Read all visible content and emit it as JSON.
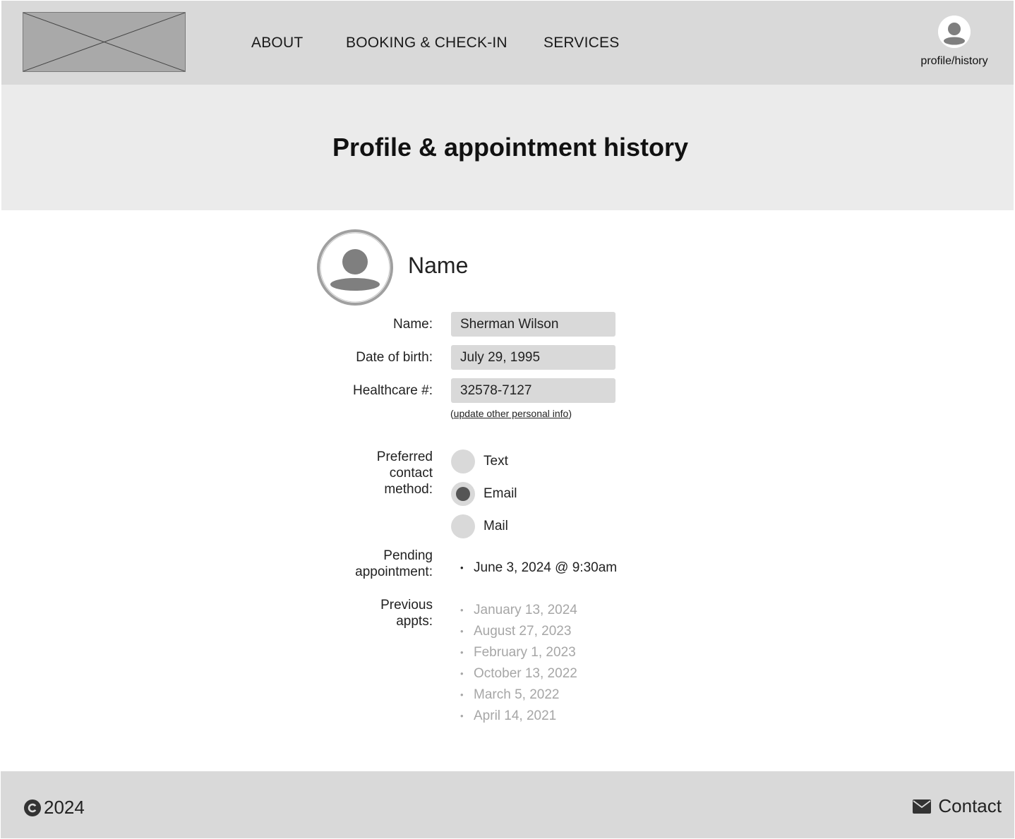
{
  "header": {
    "nav": {
      "about": "ABOUT",
      "booking": "BOOKING & CHECK-IN",
      "services": "SERVICES"
    },
    "profile_label": "profile/history"
  },
  "banner": {
    "title": "Profile & appointment history"
  },
  "profile": {
    "heading": "Name",
    "fields": {
      "name_label": "Name:",
      "name_value": "Sherman Wilson",
      "dob_label": "Date of birth:",
      "dob_value": "July 29, 1995",
      "healthcare_label": "Healthcare #:",
      "healthcare_value": "32578-7127"
    },
    "update_link": {
      "open_paren": "(",
      "text": "update other personal info",
      "close_paren": ")"
    },
    "contact_method": {
      "label_line1": "Preferred",
      "label_line2": "contact",
      "label_line3": "method:",
      "options": [
        "Text",
        "Email",
        "Mail"
      ],
      "selected": "Email"
    },
    "pending": {
      "label_line1": "Pending",
      "label_line2": "appointment:",
      "items": [
        "June 3, 2024 @ 9:30am"
      ]
    },
    "previous": {
      "label_line1": "Previous",
      "label_line2": "appts:",
      "items": [
        "January 13, 2024",
        "August 27, 2023",
        "February 1, 2023",
        "October 13, 2022",
        "March 5, 2022",
        "April 14, 2021"
      ]
    }
  },
  "footer": {
    "copyright": "2024",
    "contact": "Contact"
  },
  "icons": {
    "logo": "image-placeholder-icon",
    "profile": "user-avatar-icon",
    "copyright": "copyright-icon",
    "contact": "envelope-icon"
  },
  "colors": {
    "header_bg": "#d9d9d9",
    "banner_bg": "#ebebeb",
    "field_bg": "#d9d9d9",
    "muted_text": "#a6a6a6",
    "radio_selected": "#555555"
  }
}
